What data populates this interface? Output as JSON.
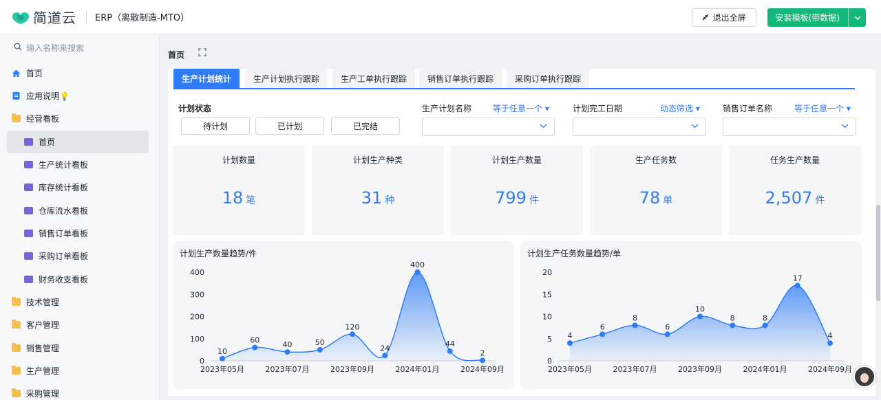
{
  "app": {
    "logo_text": "简道云",
    "name": "ERP（离散制造-MTO）"
  },
  "topbar": {
    "exit_fullscreen": "退出全屏",
    "install": "安装模板(带数据)"
  },
  "sidebar": {
    "search_placeholder": "输入名称来搜索",
    "items": [
      {
        "label": "首页",
        "icon": "home-icon"
      },
      {
        "label": "应用说明💡",
        "icon": "doc-icon"
      },
      {
        "label": "经营看板",
        "icon": "folder-open-icon"
      },
      {
        "label": "首页",
        "icon": "dashboard-icon"
      },
      {
        "label": "生产统计看板",
        "icon": "dashboard-icon"
      },
      {
        "label": "库存统计看板",
        "icon": "dashboard-icon"
      },
      {
        "label": "仓库流水看板",
        "icon": "dashboard-icon"
      },
      {
        "label": "销售订单看板",
        "icon": "dashboard-icon"
      },
      {
        "label": "采购订单看板",
        "icon": "dashboard-icon"
      },
      {
        "label": "财务收支看板",
        "icon": "dashboard-icon"
      },
      {
        "label": "技术管理",
        "icon": "folder-icon"
      },
      {
        "label": "客户管理",
        "icon": "folder-icon"
      },
      {
        "label": "销售管理",
        "icon": "folder-icon"
      },
      {
        "label": "生产管理",
        "icon": "folder-icon"
      },
      {
        "label": "采购管理",
        "icon": "folder-icon"
      }
    ]
  },
  "page": {
    "title": "首页"
  },
  "tabs": [
    "生产计划统计",
    "生产计划执行跟踪",
    "生产工单执行跟踪",
    "销售订单执行跟踪",
    "采购订单执行跟踪"
  ],
  "filters": {
    "status_label": "计划状态",
    "status_options": [
      "待计划",
      "已计划",
      "已完结"
    ],
    "plan_name_label": "生产计划名称",
    "plan_name_op": "等于任意一个",
    "finish_date_label": "计划完工日期",
    "finish_date_op": "动态筛选",
    "sales_order_label": "销售订单名称",
    "sales_order_op": "等于任意一个"
  },
  "stats": [
    {
      "title": "计划数量",
      "value": "18",
      "unit": "笔"
    },
    {
      "title": "计划生产种类",
      "value": "31",
      "unit": "种"
    },
    {
      "title": "计划生产数量",
      "value": "799",
      "unit": "件"
    },
    {
      "title": "生产任务数",
      "value": "78",
      "unit": "单"
    },
    {
      "title": "任务生产数量",
      "value": "2,507",
      "unit": "件"
    }
  ],
  "colors": {
    "accent": "#2f7cf6",
    "install_green": "#14b87a"
  },
  "chart_data": [
    {
      "type": "area",
      "title": "计划生产数量趋势/件",
      "x_tick_labels": [
        "2023年05月",
        "2023年07月",
        "2023年09月",
        "2024年01月",
        "2024年09月"
      ],
      "values": [
        10,
        60,
        40,
        50,
        120,
        24,
        400,
        44,
        2
      ],
      "ylim": [
        0,
        400
      ],
      "yticks": [
        0,
        100,
        200,
        300,
        400
      ],
      "data_labels": true,
      "grid": false
    },
    {
      "type": "area",
      "title": "计划生产任务数量趋势/单",
      "x_tick_labels": [
        "2023年05月",
        "2023年07月",
        "2023年09月",
        "2024年01月",
        "2024年09月"
      ],
      "values": [
        4,
        6,
        8,
        6,
        10,
        8,
        8,
        17,
        4
      ],
      "ylim": [
        0,
        20
      ],
      "yticks": [
        0,
        5,
        10,
        15,
        20
      ],
      "data_labels": true,
      "grid": false
    }
  ]
}
